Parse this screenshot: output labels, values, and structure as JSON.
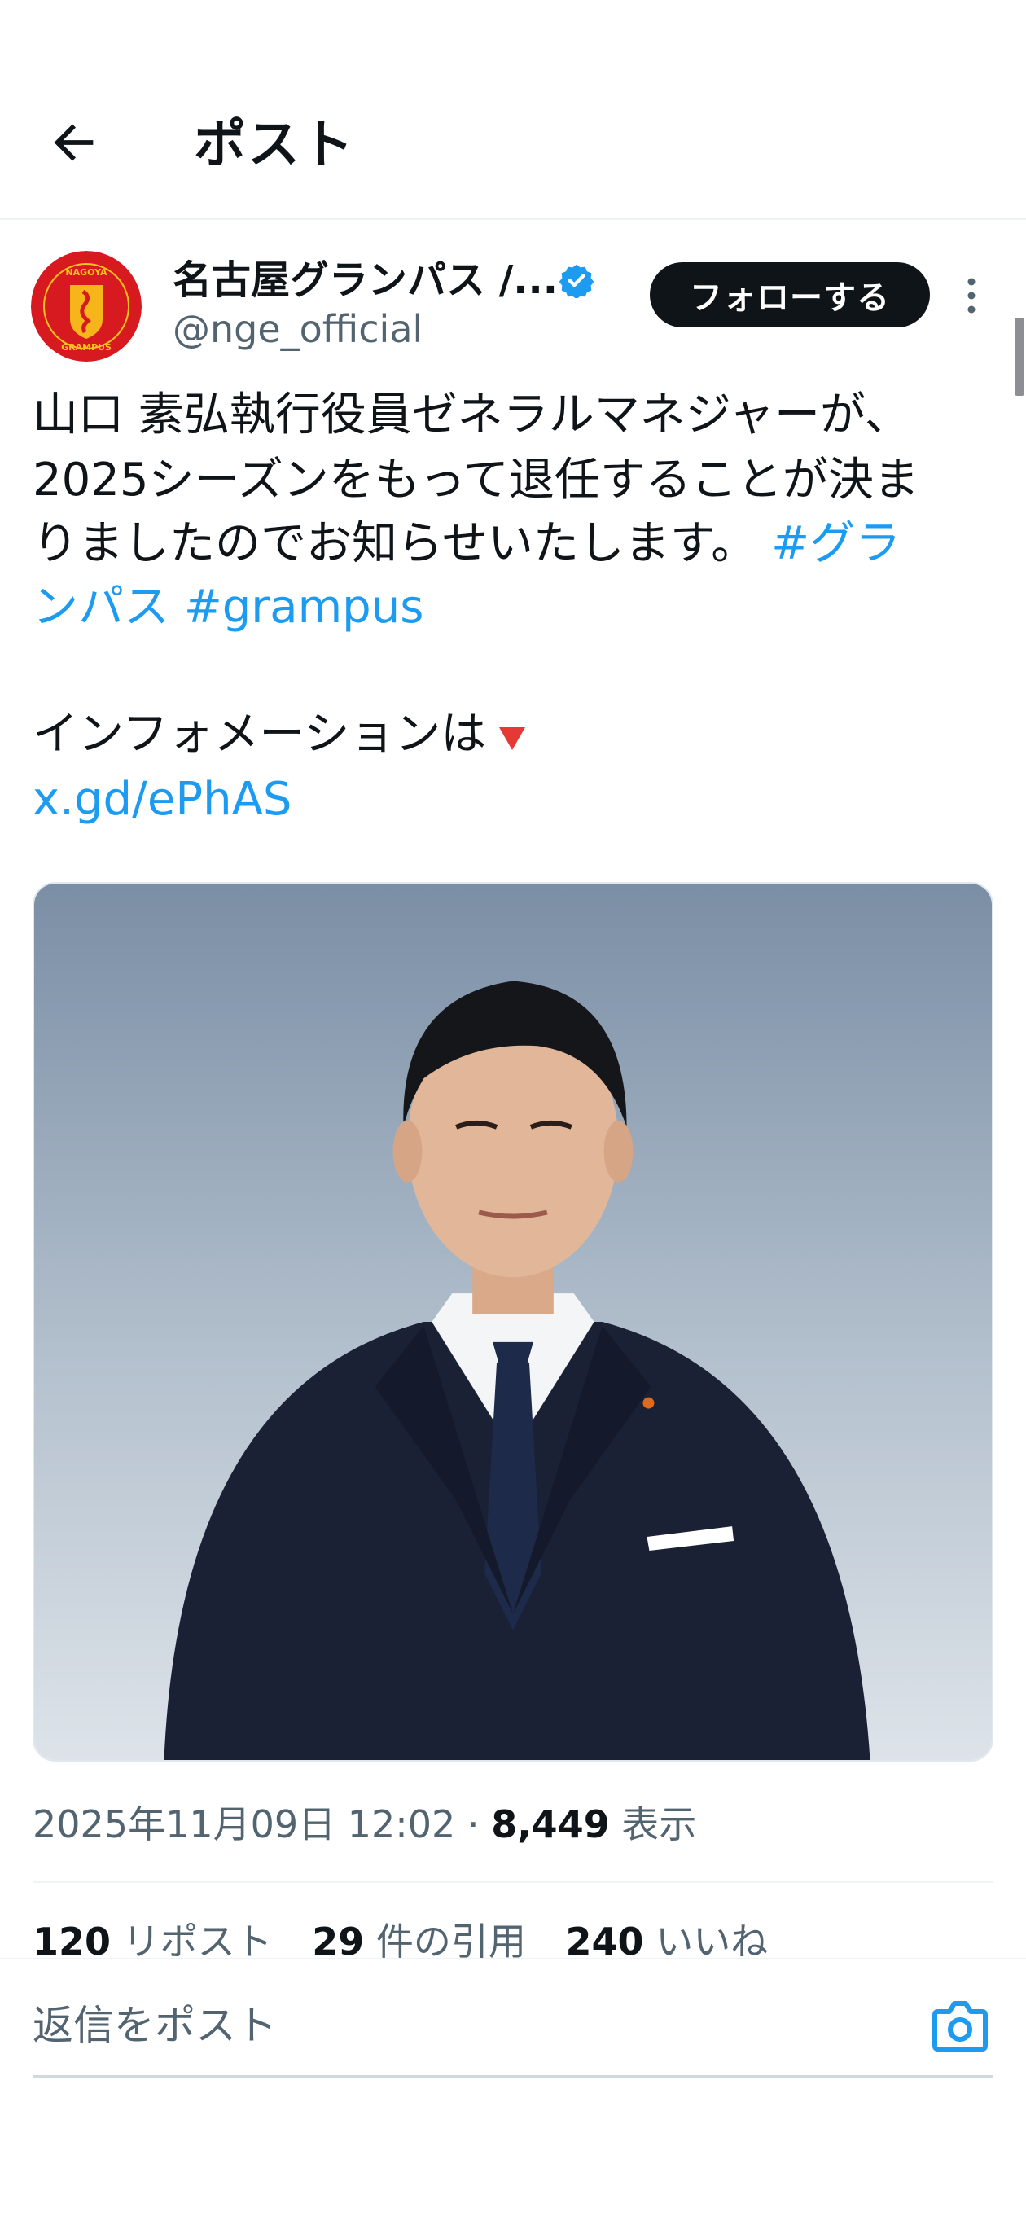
{
  "header": {
    "title": "ポスト",
    "back_icon": "arrow-left-icon"
  },
  "author": {
    "name": "名古屋グランパス /...",
    "handle": "@nge_official",
    "verified": true,
    "avatar_icon": "grampus-crest-logo",
    "avatar_text_top": "NAGOYA",
    "avatar_text_bottom": "GRAMPUS",
    "follow_label": "フォローする",
    "more_icon": "more-vertical-icon"
  },
  "tweet": {
    "line1": "山口 素弘執行役員ゼネラルマネジャーが、",
    "line2": "2025シーズンをもって退任することが決ま",
    "line3_text": "りましたのでお知らせいたします。",
    "line3_hashtag": "#グラ",
    "line4_hashtag_cont": "ンパス",
    "line4_hashtag2": "#grampus",
    "info_text": "インフォメーションは",
    "info_emoji": "red-down-triangle-icon",
    "link": "x.gd/ePhAS"
  },
  "media": {
    "description_icon": "portrait-photo"
  },
  "meta": {
    "datetime": "2025年11月09日 12:02",
    "separator": "·",
    "views_count": "8,449",
    "views_label": "表示"
  },
  "stats": {
    "reposts_count": "120",
    "reposts_label": "リポスト",
    "quotes_count": "29",
    "quotes_label": "件の引用",
    "likes_count": "240",
    "likes_label": "いいね"
  },
  "reply": {
    "placeholder": "返信をポスト",
    "camera_icon": "camera-icon"
  },
  "colors": {
    "link": "#1d9bf0",
    "follow_bg": "#0f1419",
    "verified": "#1d9bf0",
    "muted": "#536471"
  }
}
